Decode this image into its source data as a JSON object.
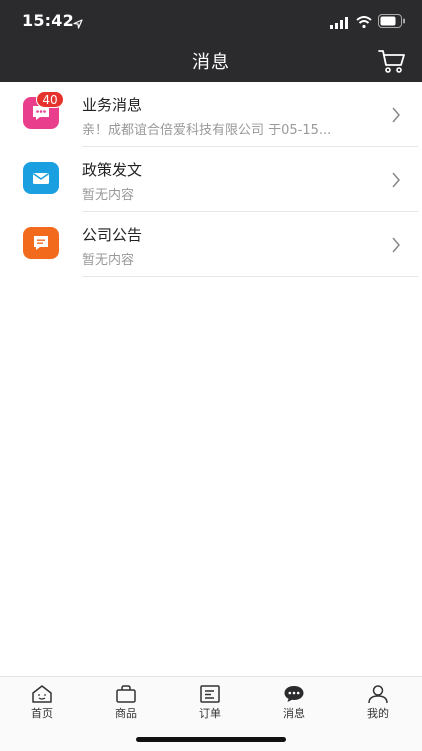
{
  "status": {
    "time": "15:42"
  },
  "header": {
    "title": "消息"
  },
  "messages": [
    {
      "title": "业务消息",
      "subtitle": "亲！成都谊合倍爱科技有限公司 于05-15...",
      "badge": "40",
      "color": "#e83e8c"
    },
    {
      "title": "政策发文",
      "subtitle": "暂无内容",
      "color": "#1aa0e0"
    },
    {
      "title": "公司公告",
      "subtitle": "暂无内容",
      "color": "#f26b1d"
    }
  ],
  "tabs": [
    {
      "label": "首页",
      "icon": "home-face-icon"
    },
    {
      "label": "商品",
      "icon": "bag-icon"
    },
    {
      "label": "订单",
      "icon": "order-list-icon"
    },
    {
      "label": "消息",
      "icon": "chat-bubble-icon",
      "active": true
    },
    {
      "label": "我的",
      "icon": "person-icon"
    }
  ]
}
